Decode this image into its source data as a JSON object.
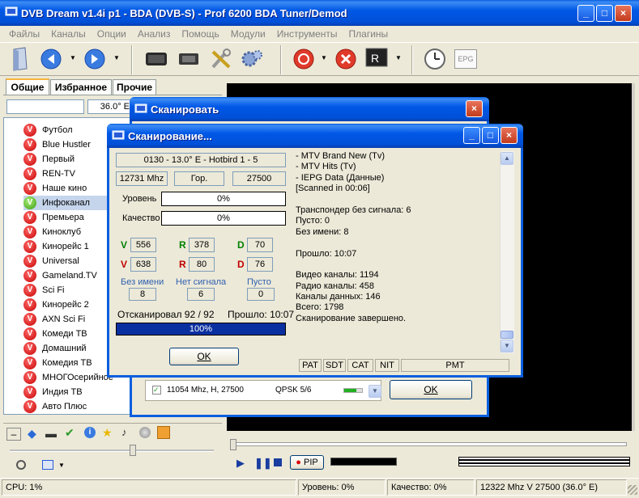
{
  "main_window": {
    "title": "DVB Dream v1.4i p1 - BDA (DVB-S)  -  Prof 6200 BDA Tuner/Demod",
    "min": "_",
    "max": "□",
    "close": "×"
  },
  "menu": [
    "Файлы",
    "Каналы",
    "Опции",
    "Анализ",
    "Помощь",
    "Модули",
    "Инструменты",
    "Плагины"
  ],
  "toolbar": {
    "epg_label": "EPG",
    "icons": [
      "satellite-dish-icon",
      "back-icon",
      "forward-icon",
      "tv-icon",
      "display-icon",
      "tools-icon",
      "settings-gear-icon",
      "record-icon",
      "stop-icon",
      "monitor-icon",
      "clock-icon",
      "epg-icon"
    ]
  },
  "tabs": [
    "Общие",
    "Избранное",
    "Прочие"
  ],
  "sat_filter": {
    "search": "",
    "position": "36.0° E"
  },
  "channels": [
    {
      "name": "Футбол"
    },
    {
      "name": "Blue Hustler"
    },
    {
      "name": "Первый"
    },
    {
      "name": "REN-TV"
    },
    {
      "name": "Наше кино"
    },
    {
      "name": "Инфоканал",
      "selected": true
    },
    {
      "name": "Премьера"
    },
    {
      "name": "Киноклуб"
    },
    {
      "name": "Кинорейс 1"
    },
    {
      "name": "Universal"
    },
    {
      "name": "Gameland.TV"
    },
    {
      "name": "Sci Fi"
    },
    {
      "name": "Кинорейс 2"
    },
    {
      "name": "AXN Sci Fi"
    },
    {
      "name": "Комеди ТВ"
    },
    {
      "name": "Домашний"
    },
    {
      "name": "Комедия ТВ"
    },
    {
      "name": "МНОГОсерийное"
    },
    {
      "name": "Индия ТВ"
    },
    {
      "name": "Авто Плюс"
    }
  ],
  "scan_window": {
    "title": "Сканировать",
    "close": "×",
    "row": {
      "text": "11054 Mhz, H, 27500",
      "modulation": "QPSK 5/6"
    },
    "ok": "OK"
  },
  "scanning_dialog": {
    "title": "Сканирование...",
    "min": "_",
    "max": "□",
    "close": "×",
    "transponder": "0130 - 13.0° E - Hotbird 1 - 5",
    "frequency": "12731 Mhz",
    "polarization": "Гор.",
    "symbol_rate": "27500",
    "level_label": "Уровень",
    "level_value": "0%",
    "level_fraction": 0,
    "quality_label": "Качество",
    "quality_value": "0%",
    "quality_fraction": 0,
    "stats_row1": {
      "v_label": "V",
      "v": "556",
      "r_label": "R",
      "r": "378",
      "d_label": "D",
      "d": "70"
    },
    "stats_row2": {
      "v_label": "V",
      "v": "638",
      "r_label": "R",
      "r": "80",
      "d_label": "D",
      "d": "76"
    },
    "no_name_label": "Без имени",
    "no_name_value": "8",
    "no_signal_label": "Нет сигнала",
    "no_signal_value": "6",
    "empty_label": "Пусто",
    "empty_value": "0",
    "scanned_text": "Отсканировал 92 / 92",
    "elapsed_text": "Прошло: 10:07",
    "progress_value": "100%",
    "progress_fraction": 1.0,
    "ok": "OK",
    "log": [
      "- MTV Brand New (Tv)",
      "- MTV Hits (Tv)",
      "- IEPG Data (Данные)",
      "[Scanned in 00:06]",
      "",
      "Транспондер без сигнала: 6",
      "Пусто: 0",
      "Без имени: 8",
      "",
      "Прошло: 10:07",
      "",
      "Видео каналы: 1194",
      "Радио каналы: 458",
      "Каналы данных: 146",
      "Всего: 1798",
      "Сканирование завершено."
    ],
    "tables": [
      "PAT",
      "SDT",
      "CAT",
      "NIT",
      "PMT"
    ]
  },
  "player": {
    "pip": "PIP"
  },
  "status": {
    "cpu": "CPU: 1%",
    "level": "Уровень: 0%",
    "quality": "Качество: 0%",
    "tuning": "12322 Mhz  V  27500  (36.0° E)"
  }
}
